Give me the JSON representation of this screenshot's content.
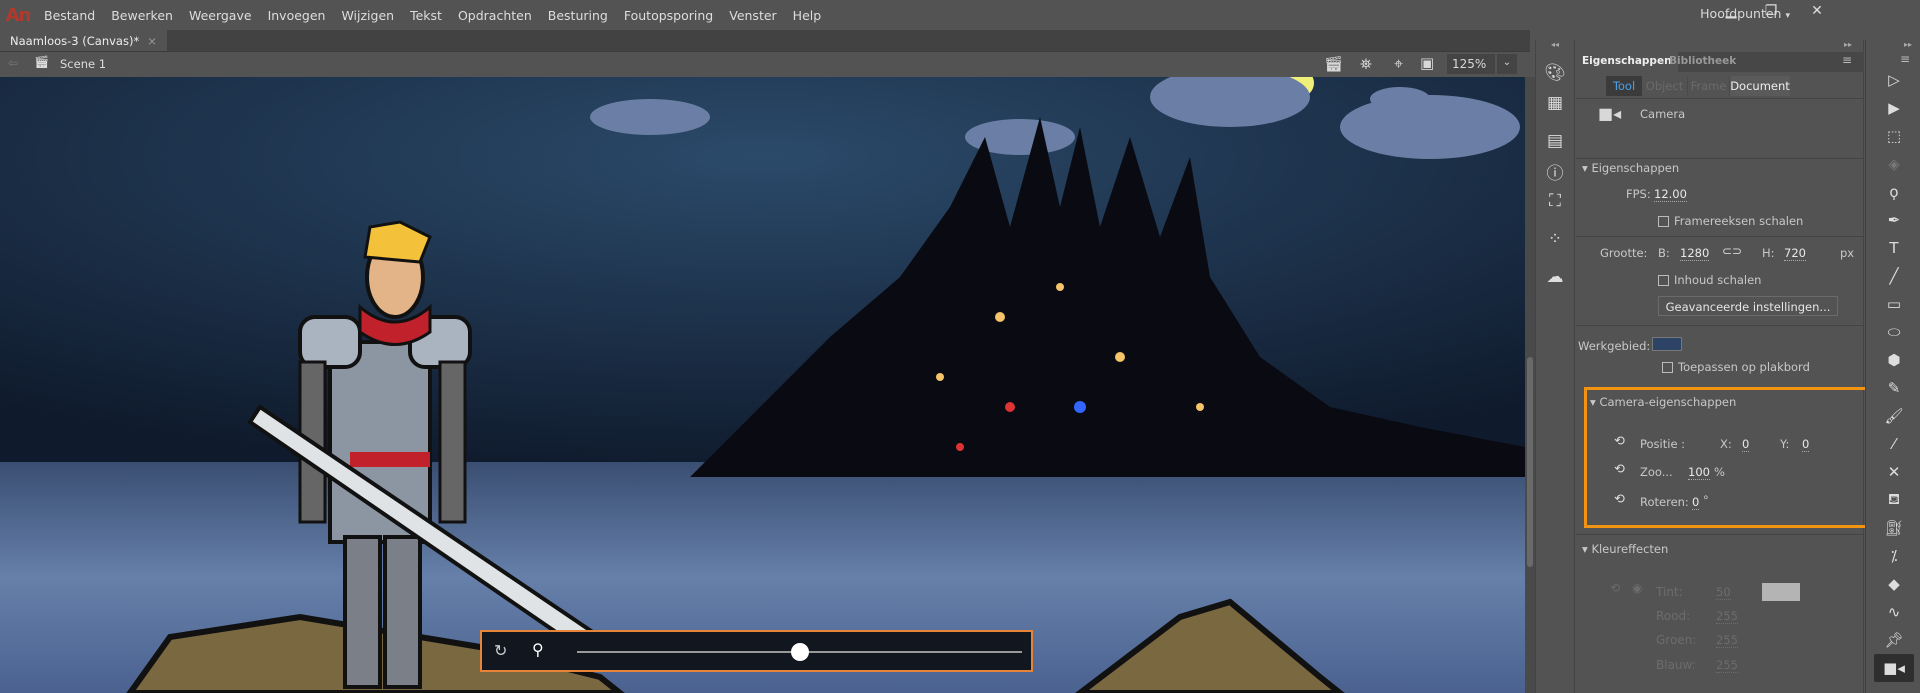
{
  "app": {
    "logo": "An",
    "menu": [
      "Bestand",
      "Bewerken",
      "Weergave",
      "Invoegen",
      "Wijzigen",
      "Tekst",
      "Opdrachten",
      "Besturing",
      "Foutopsporing",
      "Venster",
      "Help"
    ],
    "workspace": "Hoofdpunten"
  },
  "document": {
    "tab": "Naamloos-3 (Canvas)*",
    "scene": "Scene 1",
    "zoom": "125%"
  },
  "camera_bar": {
    "zoom_slider_fraction": 0.5
  },
  "panel": {
    "tabs": [
      "Eigenschappen",
      "Bibliotheek"
    ],
    "subtabs": [
      "Tool",
      "Object",
      "Frame",
      "Document"
    ],
    "tool_name": "Camera",
    "props": {
      "header": "Eigenschappen",
      "fps_label": "FPS:",
      "fps": "12.00",
      "scale_spans": "Framereeksen schalen",
      "size_label": "Grootte:",
      "w_label": "B:",
      "width": "1280",
      "h_label": "H:",
      "height": "720",
      "unit": "px",
      "scale_content": "Inhoud schalen",
      "advanced": "Geavanceerde instellingen...",
      "stage_label": "Werkgebied:",
      "stage_color": "#2d4466",
      "apply_pasteboard": "Toepassen op plakbord"
    },
    "camera": {
      "header": "Camera-eigenschappen",
      "pos_label": "Positie :",
      "x_label": "X:",
      "x": "0",
      "y_label": "Y:",
      "y": "0",
      "zoom_label": "Zoo...",
      "zoom": "100",
      "zoom_unit": "%",
      "rotate_label": "Roteren:",
      "rotate": "0",
      "rotate_unit": "°"
    },
    "color": {
      "header": "Kleureffecten",
      "tint_label": "Tint:",
      "tint": "50",
      "red_label": "Rood:",
      "red": "255",
      "green_label": "Groen:",
      "green": "255",
      "blue_label": "Blauw:",
      "blue": "255"
    }
  },
  "colors": {
    "highlight": "#f29411",
    "camera_bar_border": "#e8843a"
  }
}
